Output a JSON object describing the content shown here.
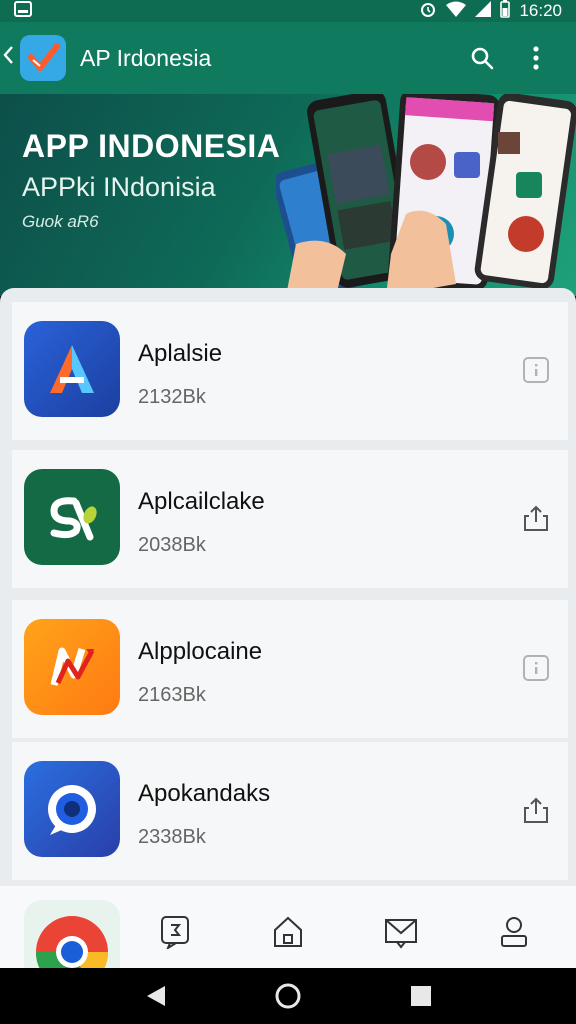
{
  "status_bar": {
    "time": "16:20",
    "icons": [
      "image-icon",
      "alarm-icon",
      "wifi-icon",
      "signal-icon",
      "battery-icon"
    ]
  },
  "app_bar": {
    "title": "AP Irdonesia",
    "icons": [
      "back-chevron-icon",
      "app-logo-check-icon",
      "search-icon",
      "overflow-menu-icon"
    ]
  },
  "banner": {
    "title": "APP INDONESIA",
    "subtitle": "APPki INdonisia",
    "tagline": "Guok aR6"
  },
  "apps": [
    {
      "name": "Aplalsie",
      "size": "2132Bk",
      "icon": "app-logo-a-icon",
      "action": "info-icon"
    },
    {
      "name": "Aplcailclake",
      "size": "2038Bk",
      "icon": "app-logo-s-icon",
      "action": "share-icon"
    },
    {
      "name": "Alpplocaine",
      "size": "2163Bk",
      "icon": "app-logo-n-icon",
      "action": "info-icon"
    },
    {
      "name": "Apokandaks",
      "size": "2338Bk",
      "icon": "app-logo-o-icon",
      "action": "share-icon"
    }
  ],
  "bottom_tabs": [
    "chat-icon",
    "home-icon",
    "mail-icon",
    "profile-icon"
  ],
  "nav_bar": [
    "back-icon",
    "home-circle-icon",
    "recents-icon"
  ],
  "colors": {
    "primary": "#0f7a5d",
    "status_bar": "#0e6c52",
    "sheet_bg": "#e9ecef"
  }
}
